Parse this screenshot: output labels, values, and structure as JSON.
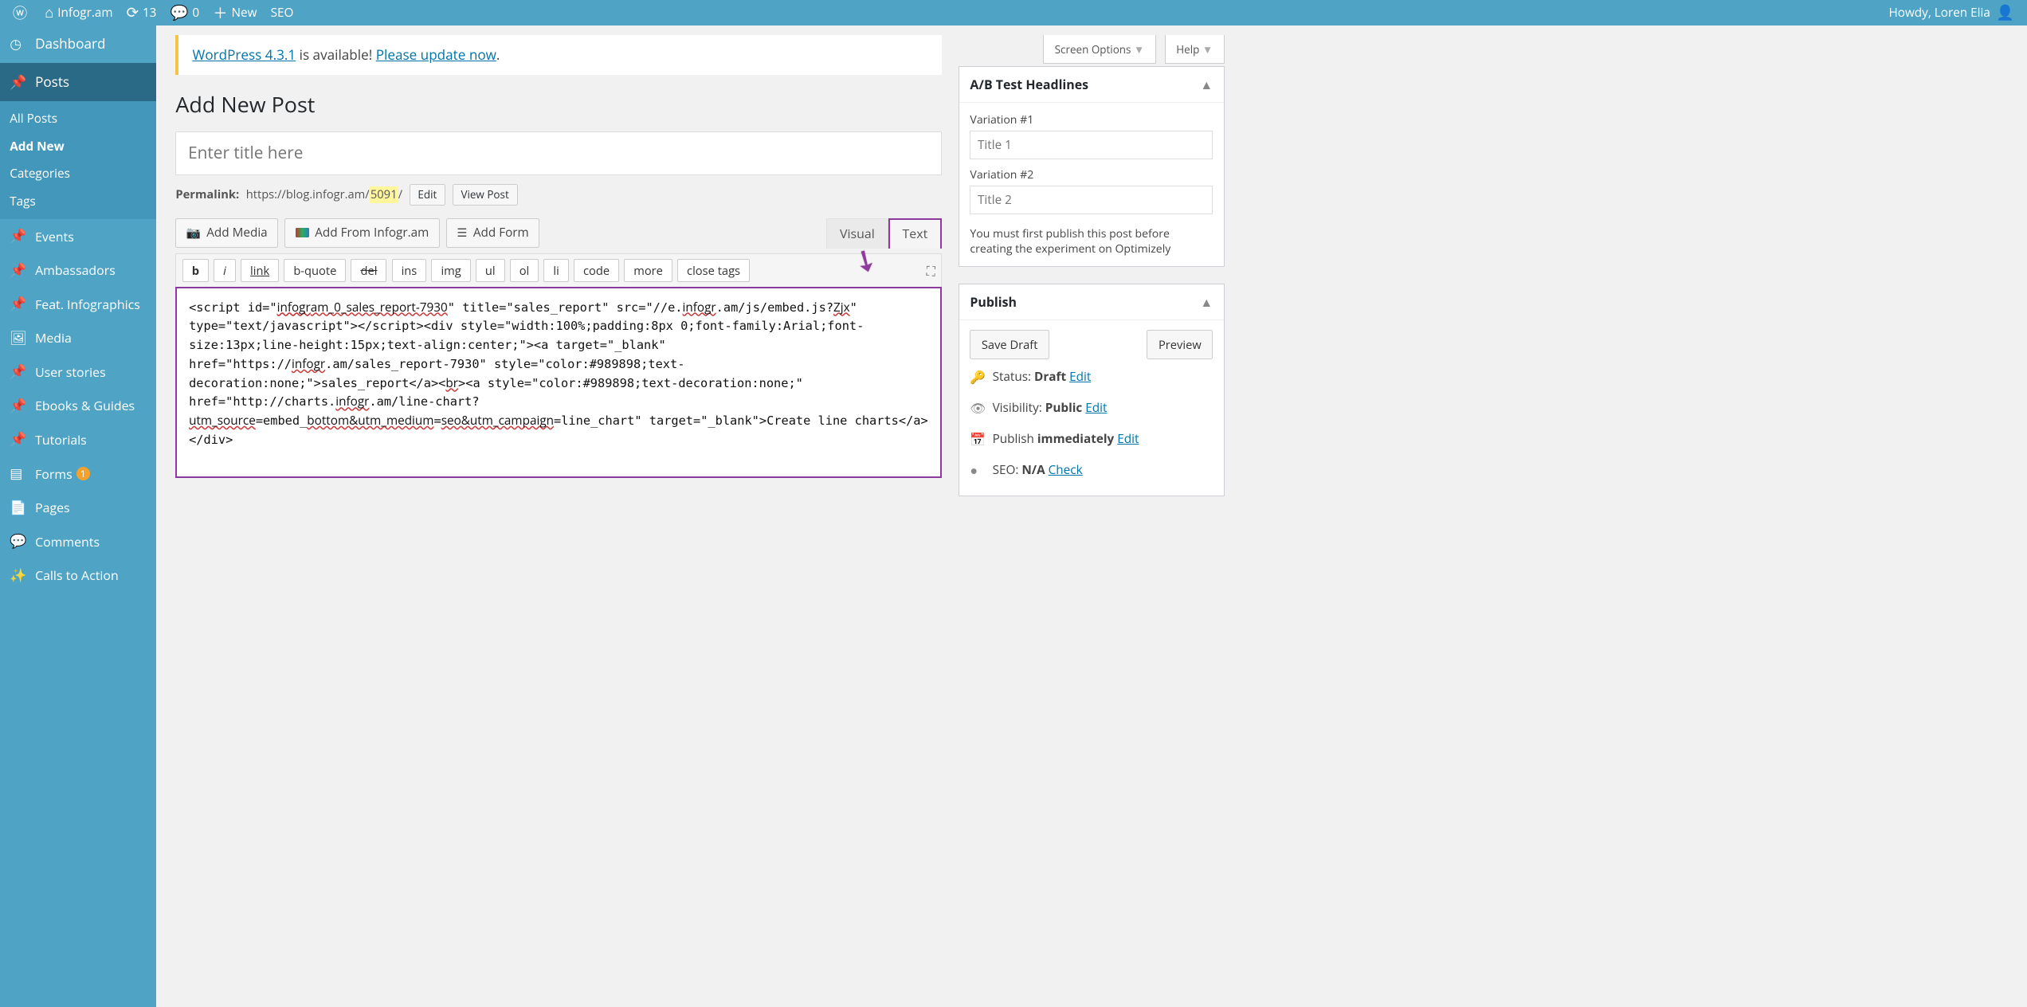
{
  "adminbar": {
    "site_name": "Infogr.am",
    "updates": "13",
    "comments": "0",
    "new_label": "New",
    "seo_label": "SEO",
    "greeting": "Howdy, Loren Elia"
  },
  "sidebar": {
    "items": [
      {
        "label": "Dashboard",
        "icon": "gauge"
      },
      {
        "label": "Posts",
        "icon": "pin",
        "active": true,
        "sub": [
          {
            "label": "All Posts"
          },
          {
            "label": "Add New",
            "current": true
          },
          {
            "label": "Categories"
          },
          {
            "label": "Tags"
          }
        ]
      },
      {
        "label": "Events",
        "icon": "pin"
      },
      {
        "label": "Ambassadors",
        "icon": "pin"
      },
      {
        "label": "Feat. Infographics",
        "icon": "pin"
      },
      {
        "label": "Media",
        "icon": "media"
      },
      {
        "label": "User stories",
        "icon": "pin"
      },
      {
        "label": "Ebooks & Guides",
        "icon": "pin"
      },
      {
        "label": "Tutorials",
        "icon": "pin"
      },
      {
        "label": "Forms",
        "icon": "form",
        "badge": "1"
      },
      {
        "label": "Pages",
        "icon": "page"
      },
      {
        "label": "Comments",
        "icon": "comment"
      },
      {
        "label": "Calls to Action",
        "icon": "cta"
      }
    ]
  },
  "top_tabs": {
    "screen_options": "Screen Options",
    "help": "Help"
  },
  "update_notice": {
    "link1": "WordPress 4.3.1",
    "mid": " is available! ",
    "link2": "Please update now",
    "end": "."
  },
  "page_title": "Add New Post",
  "title_placeholder": "Enter title here",
  "permalink": {
    "label": "Permalink:",
    "base": "https://blog.infogr.am/",
    "slug": "5091",
    "slash": "/",
    "edit": "Edit",
    "view": "View Post"
  },
  "media_buttons": {
    "add_media": "Add Media",
    "add_infogram": "Add From Infogr.am",
    "add_form": "Add Form"
  },
  "editor_tabs": {
    "visual": "Visual",
    "text": "Text"
  },
  "quicktags": [
    "b",
    "i",
    "link",
    "b-quote",
    "del",
    "ins",
    "img",
    "ul",
    "ol",
    "li",
    "code",
    "more",
    "close tags"
  ],
  "editor_content_plain": "<script id=\"infogram_0_sales_report-7930\" title=\"sales_report\" src=\"//e.infogr.am/js/embed.js?Zjx\" type=\"text/javascript\"></script><div style=\"width:100%;padding:8px 0;font-family:Arial;font-size:13px;line-height:15px;text-align:center;\"><a target=\"_blank\" href=\"https://infogr.am/sales_report-7930\" style=\"color:#989898;text-decoration:none;\">sales_report</a><br><a style=\"color:#989898;text-decoration:none;\" href=\"http://charts.infogr.am/line-chart?utm_source=embed_bottom&utm_medium=seo&utm_campaign=line_chart\" target=\"_blank\">Create line charts</a></div>",
  "editor_squiggles": [
    "infogram_0_sales_report-7930",
    "infogr",
    "Zjx",
    "br",
    "utm_source",
    "bottom&utm_medium",
    "seo&utm_campaign"
  ],
  "abtest": {
    "title": "A/B Test Headlines",
    "v1_label": "Variation #1",
    "v1_placeholder": "Title 1",
    "v2_label": "Variation #2",
    "v2_placeholder": "Title 2",
    "note": "You must first publish this post before creating the experiment on Optimizely"
  },
  "publish": {
    "title": "Publish",
    "save_draft": "Save Draft",
    "preview": "Preview",
    "status_label": "Status: ",
    "status_value": "Draft",
    "vis_label": "Visibility: ",
    "vis_value": "Public",
    "sched_label": "Publish ",
    "sched_value": "immediately",
    "seo_label": "SEO: ",
    "seo_value": "N/A",
    "edit_link": "Edit",
    "check_link": "Check"
  }
}
